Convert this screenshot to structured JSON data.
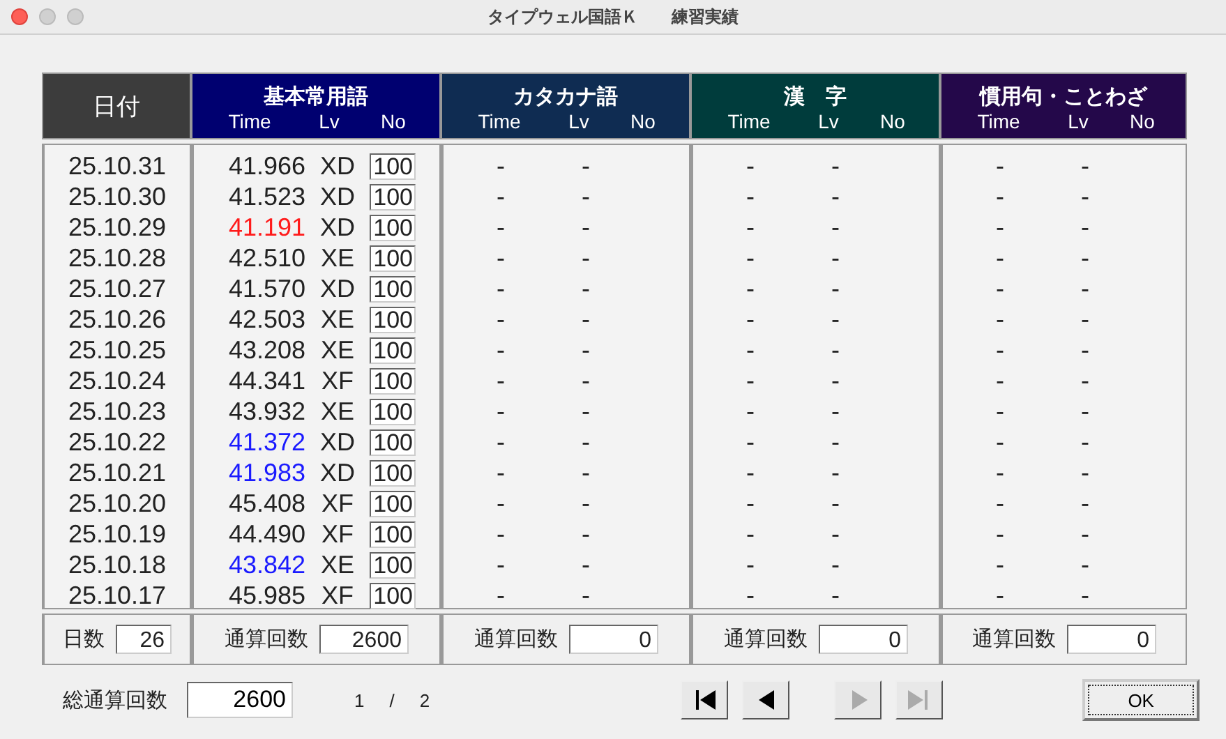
{
  "window": {
    "title": "タイプウェル国語Ｋ　　練習実績"
  },
  "date_column": {
    "header": "日付",
    "footer_label": "日数",
    "footer_value": "26"
  },
  "categories": [
    {
      "name": "基本常用語",
      "color": "#000070",
      "sub_headers": [
        "Time",
        "Lv",
        "No"
      ],
      "footer_label": "通算回数",
      "footer_value": "2600",
      "rows": [
        {
          "time": "41.966",
          "lv": "XD",
          "no": "100",
          "color": "#222222"
        },
        {
          "time": "41.523",
          "lv": "XD",
          "no": "100",
          "color": "#222222"
        },
        {
          "time": "41.191",
          "lv": "XD",
          "no": "100",
          "color": "#ff1a1a"
        },
        {
          "time": "42.510",
          "lv": "XE",
          "no": "100",
          "color": "#222222"
        },
        {
          "time": "41.570",
          "lv": "XD",
          "no": "100",
          "color": "#222222"
        },
        {
          "time": "42.503",
          "lv": "XE",
          "no": "100",
          "color": "#222222"
        },
        {
          "time": "43.208",
          "lv": "XE",
          "no": "100",
          "color": "#222222"
        },
        {
          "time": "44.341",
          "lv": "XF",
          "no": "100",
          "color": "#222222"
        },
        {
          "time": "43.932",
          "lv": "XE",
          "no": "100",
          "color": "#222222"
        },
        {
          "time": "41.372",
          "lv": "XD",
          "no": "100",
          "color": "#1a1aff"
        },
        {
          "time": "41.983",
          "lv": "XD",
          "no": "100",
          "color": "#1a1aff"
        },
        {
          "time": "45.408",
          "lv": "XF",
          "no": "100",
          "color": "#222222"
        },
        {
          "time": "44.490",
          "lv": "XF",
          "no": "100",
          "color": "#222222"
        },
        {
          "time": "43.842",
          "lv": "XE",
          "no": "100",
          "color": "#1a1aff"
        },
        {
          "time": "45.985",
          "lv": "XF",
          "no": "100",
          "color": "#222222"
        }
      ]
    },
    {
      "name": "カタカナ語",
      "color": "#0f2c52",
      "sub_headers": [
        "Time",
        "Lv",
        "No"
      ],
      "footer_label": "通算回数",
      "footer_value": "0",
      "rows": [
        {
          "time": "-",
          "lv": "-"
        },
        {
          "time": "-",
          "lv": "-"
        },
        {
          "time": "-",
          "lv": "-"
        },
        {
          "time": "-",
          "lv": "-"
        },
        {
          "time": "-",
          "lv": "-"
        },
        {
          "time": "-",
          "lv": "-"
        },
        {
          "time": "-",
          "lv": "-"
        },
        {
          "time": "-",
          "lv": "-"
        },
        {
          "time": "-",
          "lv": "-"
        },
        {
          "time": "-",
          "lv": "-"
        },
        {
          "time": "-",
          "lv": "-"
        },
        {
          "time": "-",
          "lv": "-"
        },
        {
          "time": "-",
          "lv": "-"
        },
        {
          "time": "-",
          "lv": "-"
        },
        {
          "time": "-",
          "lv": "-"
        }
      ]
    },
    {
      "name": "漢　字",
      "color": "#003c3c",
      "sub_headers": [
        "Time",
        "Lv",
        "No"
      ],
      "footer_label": "通算回数",
      "footer_value": "0",
      "rows": [
        {
          "time": "-",
          "lv": "-"
        },
        {
          "time": "-",
          "lv": "-"
        },
        {
          "time": "-",
          "lv": "-"
        },
        {
          "time": "-",
          "lv": "-"
        },
        {
          "time": "-",
          "lv": "-"
        },
        {
          "time": "-",
          "lv": "-"
        },
        {
          "time": "-",
          "lv": "-"
        },
        {
          "time": "-",
          "lv": "-"
        },
        {
          "time": "-",
          "lv": "-"
        },
        {
          "time": "-",
          "lv": "-"
        },
        {
          "time": "-",
          "lv": "-"
        },
        {
          "time": "-",
          "lv": "-"
        },
        {
          "time": "-",
          "lv": "-"
        },
        {
          "time": "-",
          "lv": "-"
        },
        {
          "time": "-",
          "lv": "-"
        }
      ]
    },
    {
      "name": "慣用句・ことわざ",
      "color": "#24084a",
      "sub_headers": [
        "Time",
        "Lv",
        "No"
      ],
      "footer_label": "通算回数",
      "footer_value": "0",
      "rows": [
        {
          "time": "-",
          "lv": "-"
        },
        {
          "time": "-",
          "lv": "-"
        },
        {
          "time": "-",
          "lv": "-"
        },
        {
          "time": "-",
          "lv": "-"
        },
        {
          "time": "-",
          "lv": "-"
        },
        {
          "time": "-",
          "lv": "-"
        },
        {
          "time": "-",
          "lv": "-"
        },
        {
          "time": "-",
          "lv": "-"
        },
        {
          "time": "-",
          "lv": "-"
        },
        {
          "time": "-",
          "lv": "-"
        },
        {
          "time": "-",
          "lv": "-"
        },
        {
          "time": "-",
          "lv": "-"
        },
        {
          "time": "-",
          "lv": "-"
        },
        {
          "time": "-",
          "lv": "-"
        },
        {
          "time": "-",
          "lv": "-"
        }
      ]
    }
  ],
  "dates": [
    "25.10.31",
    "25.10.30",
    "25.10.29",
    "25.10.28",
    "25.10.27",
    "25.10.26",
    "25.10.25",
    "25.10.24",
    "25.10.23",
    "25.10.22",
    "25.10.21",
    "25.10.20",
    "25.10.19",
    "25.10.18",
    "25.10.17"
  ],
  "total": {
    "label": "総通算回数",
    "value": "2600"
  },
  "page": {
    "current": "1",
    "separator": "/",
    "count": "2"
  },
  "nav_buttons": [
    {
      "kind": "first",
      "disabled": false
    },
    {
      "kind": "prev",
      "disabled": false
    },
    {
      "kind": "next",
      "disabled": true
    },
    {
      "kind": "last",
      "disabled": true
    }
  ],
  "ok_button": "OK"
}
